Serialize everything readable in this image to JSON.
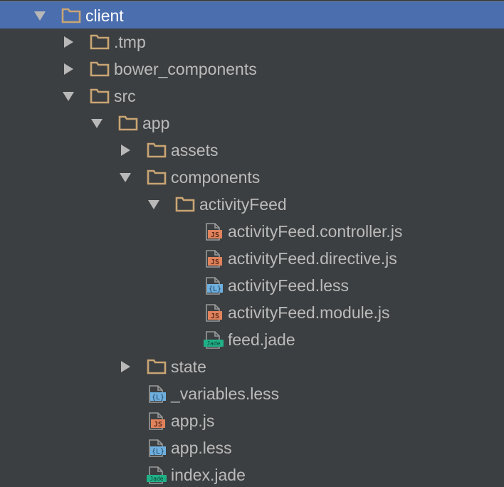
{
  "tree": {
    "items": [
      {
        "label": "client",
        "type": "folder",
        "expanded": true,
        "depth": 0,
        "selected": true,
        "icon": "folder-icon"
      },
      {
        "label": ".tmp",
        "type": "folder",
        "expanded": false,
        "depth": 1,
        "icon": "folder-icon"
      },
      {
        "label": "bower_components",
        "type": "folder",
        "expanded": false,
        "depth": 1,
        "icon": "folder-icon"
      },
      {
        "label": "src",
        "type": "folder",
        "expanded": true,
        "depth": 1,
        "icon": "folder-icon"
      },
      {
        "label": "app",
        "type": "folder",
        "expanded": true,
        "depth": 2,
        "icon": "folder-icon"
      },
      {
        "label": "assets",
        "type": "folder",
        "expanded": false,
        "depth": 3,
        "icon": "folder-icon"
      },
      {
        "label": "components",
        "type": "folder",
        "expanded": true,
        "depth": 3,
        "icon": "folder-icon"
      },
      {
        "label": "activityFeed",
        "type": "folder",
        "expanded": true,
        "depth": 4,
        "icon": "folder-icon"
      },
      {
        "label": "activityFeed.controller.js",
        "type": "js",
        "depth": 5,
        "icon": "js-file-icon",
        "badge": "JS"
      },
      {
        "label": "activityFeed.directive.js",
        "type": "js",
        "depth": 5,
        "icon": "js-file-icon",
        "badge": "JS"
      },
      {
        "label": "activityFeed.less",
        "type": "less",
        "depth": 5,
        "icon": "less-file-icon",
        "badge": "{L}"
      },
      {
        "label": "activityFeed.module.js",
        "type": "js",
        "depth": 5,
        "icon": "js-file-icon",
        "badge": "JS"
      },
      {
        "label": "feed.jade",
        "type": "jade",
        "depth": 5,
        "icon": "jade-file-icon",
        "badge": "Jade"
      },
      {
        "label": "state",
        "type": "folder",
        "expanded": false,
        "depth": 3,
        "icon": "folder-icon"
      },
      {
        "label": "_variables.less",
        "type": "less",
        "depth": 3,
        "icon": "less-file-icon",
        "badge": "{L}"
      },
      {
        "label": "app.js",
        "type": "js",
        "depth": 3,
        "icon": "js-file-icon",
        "badge": "JS"
      },
      {
        "label": "app.less",
        "type": "less",
        "depth": 3,
        "icon": "less-file-icon",
        "badge": "{L}"
      },
      {
        "label": "index.jade",
        "type": "jade",
        "depth": 3,
        "icon": "jade-file-icon",
        "badge": "Jade"
      }
    ]
  },
  "colors": {
    "background": "#3c3f41",
    "selection": "#4b6eaf",
    "text": "#bbbbbb",
    "folder": "#c9a574",
    "js": "#e0825c",
    "less": "#6eb0e0",
    "jade": "#20b088",
    "arrow": "#b8b8b8"
  }
}
